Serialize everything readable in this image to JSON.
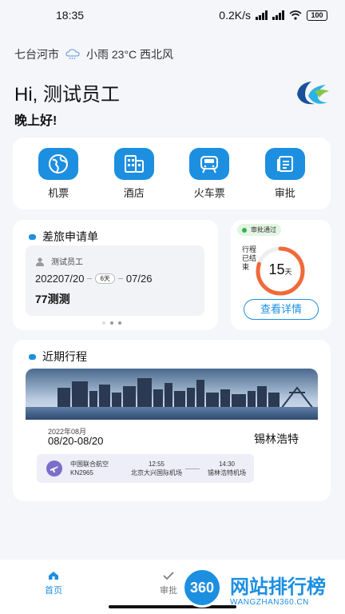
{
  "status_bar": {
    "time": "18:35",
    "speed": "0.2K/s",
    "battery": "100"
  },
  "weather": {
    "city": "七台河市",
    "text": "小雨 23°C 西北风",
    "icon": "cloud-rain-icon"
  },
  "greeting": {
    "hi": "Hi, 测试员工",
    "sub": "晚上好!"
  },
  "quick_actions": [
    {
      "label": "机票",
      "icon": "globe-icon"
    },
    {
      "label": "酒店",
      "icon": "hotel-icon"
    },
    {
      "label": "火车票",
      "icon": "train-icon"
    },
    {
      "label": "审批",
      "icon": "approval-icon"
    }
  ],
  "apply_card": {
    "title": "差旅申请单",
    "person": "测试员工",
    "start": "202207/20",
    "days": "6天",
    "end": "07/26",
    "trip_name": "77测测"
  },
  "status_card": {
    "badge": "审批通过",
    "ended_label": "行程已结束",
    "count": "15",
    "unit": "天",
    "progress": 0.8,
    "detail_button": "查看详情"
  },
  "recent": {
    "title": "近期行程",
    "year_month": "2022年08月",
    "date_range": "08/20-08/20",
    "destination": "锡林浩特",
    "flight": {
      "airline": "中国联合航空",
      "number": "KN2965",
      "dep_time": "12:55",
      "dep_airport": "北京大兴国际机场",
      "arr_time": "14:30",
      "arr_airport": "锡林浩特机场"
    }
  },
  "tabs": [
    {
      "label": "首页",
      "icon": "home-icon"
    },
    {
      "label": "审批",
      "icon": "check-icon"
    }
  ],
  "watermark": {
    "badge": "360",
    "title": "网站排行榜",
    "url": "WANGZHAN360.CN"
  },
  "colors": {
    "accent": "#1d8fe0",
    "success": "#36b24a",
    "ring": "#f06a3a"
  }
}
